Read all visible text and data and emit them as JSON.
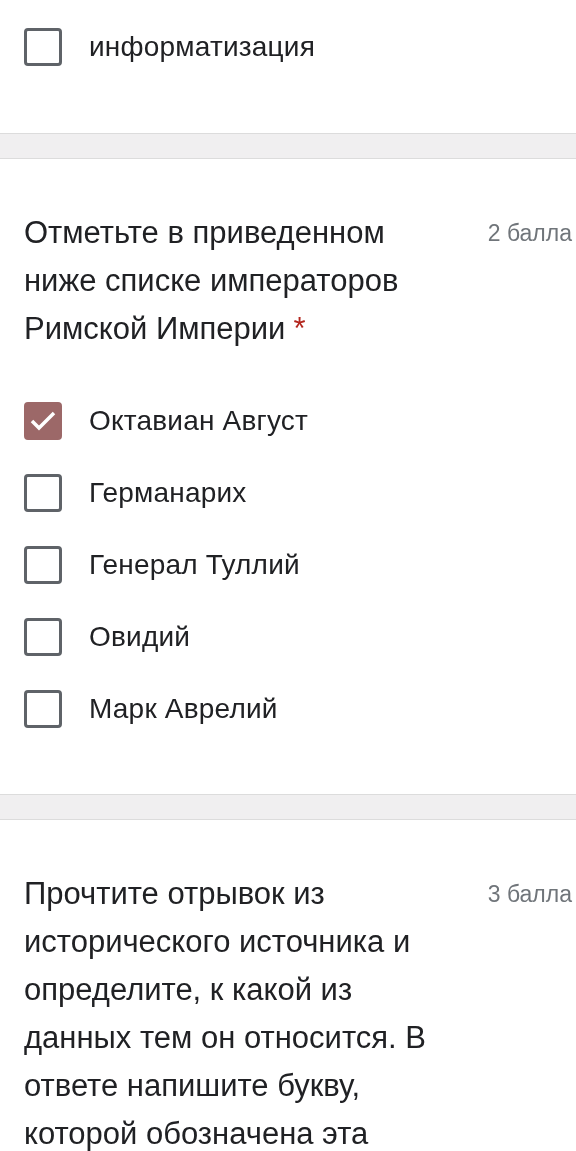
{
  "top_options": [
    {
      "label": "информатизация",
      "checked": false
    }
  ],
  "questions": [
    {
      "title": "Отметьте в приведенном ниже списке императоров Римской Империи",
      "required_mark": "*",
      "points": "2 балла",
      "options": [
        {
          "label": "Октавиан Август",
          "checked": true
        },
        {
          "label": "Германарих",
          "checked": false
        },
        {
          "label": "Генерал Туллий",
          "checked": false
        },
        {
          "label": "Овидий",
          "checked": false
        },
        {
          "label": "Марк Аврелий",
          "checked": false
        }
      ]
    },
    {
      "title": "Прочтите отрывок из исторического источника и определите, к какой из данных тем он относится. В ответе напишите букву, которой обозначена эта",
      "points": "3 балла"
    }
  ]
}
